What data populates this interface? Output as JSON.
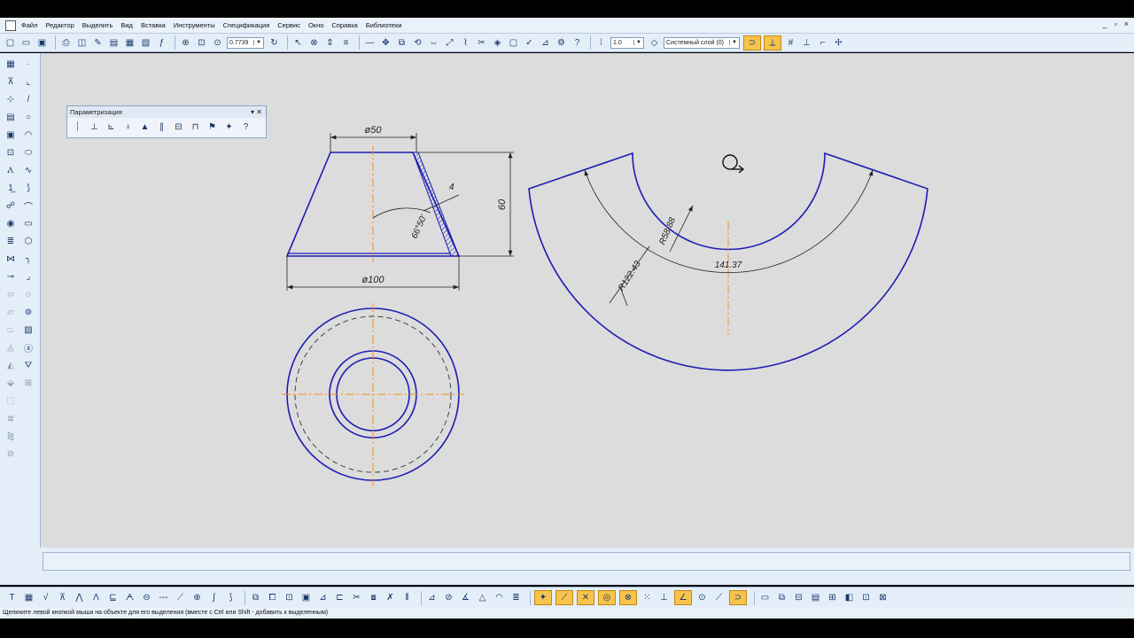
{
  "menu": {
    "items": [
      "Файл",
      "Редактор",
      "Выделить",
      "Вид",
      "Вставка",
      "Инструменты",
      "Спецификация",
      "Сервис",
      "Окно",
      "Справка",
      "Библиотеки"
    ],
    "window_controls": [
      "_",
      "▫",
      "×"
    ]
  },
  "toolbar": {
    "zoom_value": "0.7739",
    "step_value": "1.0",
    "layer_value": "Системный слой (0)"
  },
  "parametrization_panel": {
    "title": "Параметризация"
  },
  "drawing": {
    "dim_top_diameter": "ø50",
    "dim_bottom_diameter": "ø100",
    "dim_height": "60",
    "dim_thickness": "4",
    "dim_angle": "66°50'",
    "dim_inner_radius": "R58.88",
    "dim_outer_radius": "R122.43",
    "dim_arc_length": "141.37"
  },
  "status_bar": {
    "text": "Щелкните левой кнопкой мыши на объекте для его выделения (вместе с Ctrl или Shift - добавить к выделенным)"
  },
  "colors": {
    "canvas": "#dcdcdc",
    "outline": "#1c1cb4",
    "axis": "#ff8c1a",
    "dimension": "#222222"
  }
}
